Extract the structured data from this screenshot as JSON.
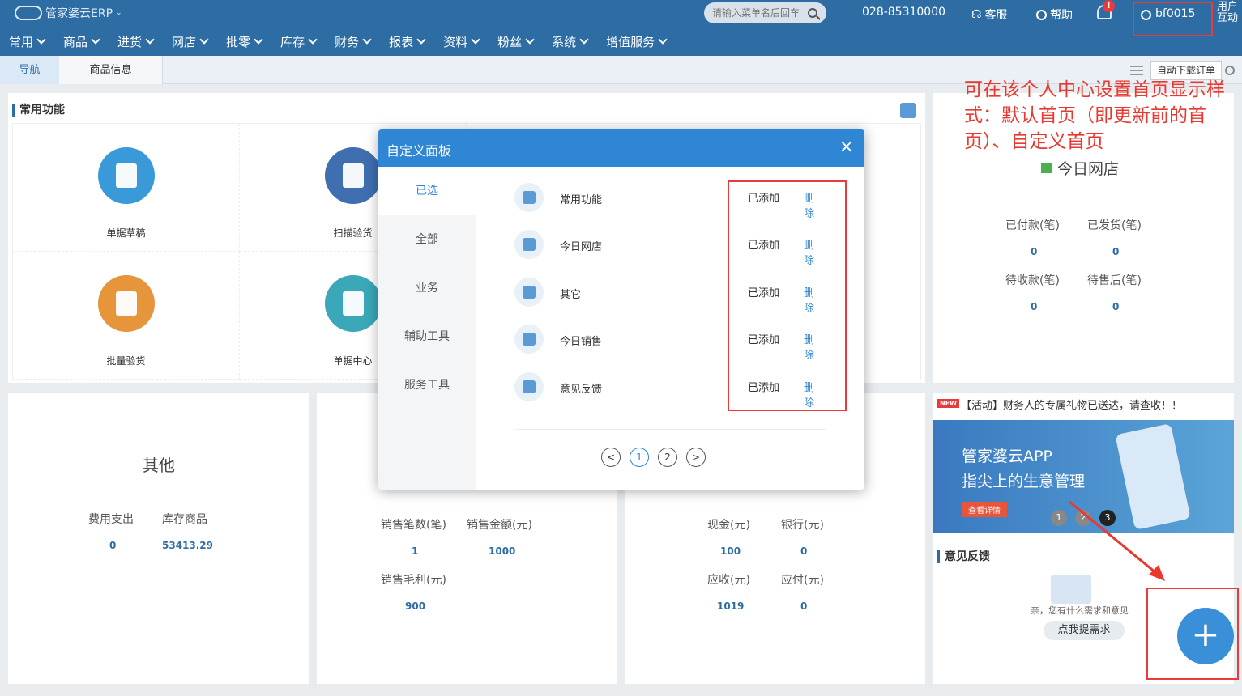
{
  "app": {
    "logo_text": "管家婆云ERP",
    "search_placeholder": "请输入菜单名后回车",
    "phone": "028-85310000",
    "service_label": "客服",
    "help_label": "帮助",
    "bell_badge": "!",
    "username": "bf0015",
    "interact_label": "用户互动"
  },
  "menu": [
    "常用",
    "商品",
    "进货",
    "网店",
    "批零",
    "库存",
    "财务",
    "报表",
    "资料",
    "粉丝",
    "系统",
    "增值服务"
  ],
  "tabs": {
    "nav": "导航",
    "goods": "商品信息",
    "auto_download": "自动下载订单"
  },
  "common": {
    "title": "常用功能",
    "items": [
      "单据草稿",
      "扫描验货",
      "批量验货",
      "单据中心"
    ]
  },
  "today_shop": {
    "title": "今日网店",
    "paid_label": "已付款(笔)",
    "paid": "0",
    "shipped_label": "已发货(笔)",
    "shipped": "0",
    "pending_label": "待收款(笔)",
    "pending": "0",
    "aftersale_label": "待售后(笔)",
    "aftersale": "0"
  },
  "other": {
    "title": "其他",
    "expense_label": "费用支出",
    "expense": "0",
    "stock_label": "库存商品",
    "stock": "53413.29"
  },
  "sales": {
    "count_label": "销售笔数(笔)",
    "count": "1",
    "amount_label": "销售金额(元)",
    "amount": "1000",
    "profit_label": "销售毛利(元)",
    "profit": "900"
  },
  "funds": {
    "cash_label": "现金(元)",
    "cash": "100",
    "bank_label": "银行(元)",
    "bank": "0",
    "receivable_label": "应收(元)",
    "receivable": "1019",
    "payable_label": "应付(元)",
    "payable": "0"
  },
  "news": {
    "badge": "NEW",
    "text": "【活动】财务人的专属礼物已送达，请查收！！"
  },
  "banner": {
    "line1": "管家婆云APP",
    "line2": "指尖上的生意管理",
    "btn": "查看详情",
    "dots": [
      "1",
      "2",
      "3"
    ]
  },
  "feedback": {
    "title": "意见反馈",
    "prompt": "亲，您有什么需求和意见",
    "button": "点我提需求"
  },
  "modal": {
    "title": "自定义面板",
    "close": "×",
    "nav": [
      "已选",
      "全部",
      "业务",
      "辅助工具",
      "服务工具"
    ],
    "rows": [
      {
        "name": "常用功能",
        "status": "已添加",
        "action": "删除"
      },
      {
        "name": "今日网店",
        "status": "已添加",
        "action": "删除"
      },
      {
        "name": "其它",
        "status": "已添加",
        "action": "删除"
      },
      {
        "name": "今日销售",
        "status": "已添加",
        "action": "删除"
      },
      {
        "name": "意见反馈",
        "status": "已添加",
        "action": "删除"
      }
    ],
    "pages": [
      "1",
      "2"
    ],
    "prev": "<",
    "next": ">"
  },
  "annotation": "可在该个人中心设置首页显示样式：默认首页（即更新前的首页）、自定义首页",
  "fab": "+"
}
